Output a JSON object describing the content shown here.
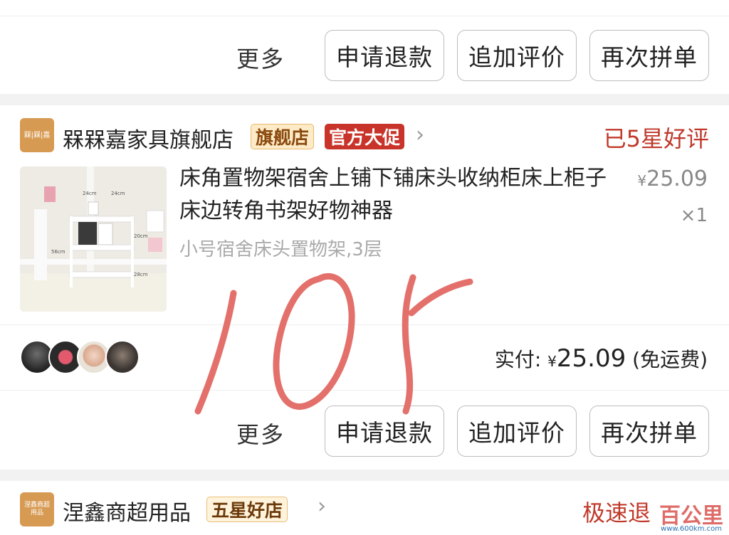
{
  "order1": {
    "more_label": "更多",
    "refund_label": "申请退款",
    "review_label": "追加评价",
    "reorder_label": "再次拼单"
  },
  "order2": {
    "store": {
      "logo_text": "槑|槑|嘉",
      "name": "槑槑嘉家具旗舰店",
      "flag_tag": "旗舰店",
      "promo_tag": "官方大促",
      "status": "已5星好评"
    },
    "product": {
      "title": "床角置物架宿舍上铺下铺床头收纳柜床上柜子床边转角书架好物神器",
      "price_currency": "¥",
      "price": "25.09",
      "quantity": "×1",
      "spec": "小号宿舍床头置物架,3层",
      "image_labels": [
        "24cm",
        "24cm",
        "20cm",
        "56cm",
        "28cm"
      ]
    },
    "payment": {
      "label": "实付:",
      "currency": "¥",
      "amount": "25.09",
      "note": "(免运费)"
    },
    "more_label": "更多",
    "refund_label": "申请退款",
    "review_label": "追加评价",
    "reorder_label": "再次拼单"
  },
  "order3": {
    "store": {
      "logo_text": "涅鑫商超用品",
      "name": "涅鑫商超用品",
      "tag": "五星好店",
      "status": "极速退"
    }
  },
  "overlay": {
    "handwriting_text": "10Y",
    "watermark": "百公里",
    "watermark_url": "www.600km.com"
  },
  "colors": {
    "accent_red": "#c0392b",
    "promo_red": "#c8342a",
    "handwriting": "#e3706a",
    "flag_bg": "#fdeac6"
  }
}
